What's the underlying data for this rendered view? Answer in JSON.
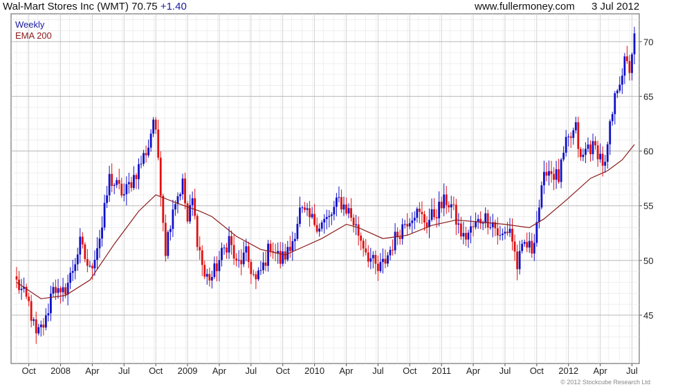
{
  "header": {
    "title_prefix": "Wal-Mart Stores Inc (WMT) 70.75",
    "change": "+1.40",
    "source": "www.fullermoney.com",
    "date": "3 Jul 2012"
  },
  "footer": {
    "copyright": "© 2012 Stockcube Research Ltd"
  },
  "colors": {
    "up": "#1010c8",
    "down": "#e01010",
    "ema": "#8b1a1a",
    "grid": "#c8c8c8",
    "title_blue": "#1a1aa0"
  },
  "chart_data": {
    "type": "candlestick",
    "title": "Wal-Mart Stores Inc (WMT) 70.75 +1.40",
    "frequency": "Weekly",
    "grid": true,
    "legend_position": "top-left",
    "ylim": [
      41.5,
      72
    ],
    "y_ticks": [
      45,
      50,
      55,
      60,
      65,
      70
    ],
    "x_ticks": [
      {
        "label": "Oct",
        "week": 5
      },
      {
        "label": "2008",
        "week": 18
      },
      {
        "label": "Apr",
        "week": 31
      },
      {
        "label": "Jul",
        "week": 44
      },
      {
        "label": "Oct",
        "week": 57
      },
      {
        "label": "2009",
        "week": 70
      },
      {
        "label": "Apr",
        "week": 83
      },
      {
        "label": "Jul",
        "week": 96
      },
      {
        "label": "Oct",
        "week": 109
      },
      {
        "label": "2010",
        "week": 122
      },
      {
        "label": "Apr",
        "week": 135
      },
      {
        "label": "Jul",
        "week": 148
      },
      {
        "label": "Oct",
        "week": 161
      },
      {
        "label": "2011",
        "week": 174
      },
      {
        "label": "Apr",
        "week": 187
      },
      {
        "label": "Jul",
        "week": 200
      },
      {
        "label": "Oct",
        "week": 213
      },
      {
        "label": "2012",
        "week": 226
      },
      {
        "label": "Apr",
        "week": 239
      },
      {
        "label": "Jul",
        "week": 252
      }
    ],
    "anchor_points": [
      {
        "week": 0,
        "price": 48.0
      },
      {
        "week": 5,
        "price": 46.0
      },
      {
        "week": 8,
        "price": 43.0
      },
      {
        "week": 12,
        "price": 44.5
      },
      {
        "week": 15,
        "price": 48.0
      },
      {
        "week": 18,
        "price": 46.5
      },
      {
        "week": 22,
        "price": 48.5
      },
      {
        "week": 26,
        "price": 51.5
      },
      {
        "week": 30,
        "price": 49.0
      },
      {
        "week": 35,
        "price": 53.0
      },
      {
        "week": 38,
        "price": 57.5
      },
      {
        "week": 44,
        "price": 56.0
      },
      {
        "week": 50,
        "price": 58.5
      },
      {
        "week": 54,
        "price": 60.5
      },
      {
        "week": 56,
        "price": 63.0
      },
      {
        "week": 58,
        "price": 59.5
      },
      {
        "week": 61,
        "price": 51.0
      },
      {
        "week": 64,
        "price": 55.0
      },
      {
        "week": 68,
        "price": 57.0
      },
      {
        "week": 70,
        "price": 53.5
      },
      {
        "week": 72,
        "price": 55.5
      },
      {
        "week": 74,
        "price": 52.0
      },
      {
        "week": 77,
        "price": 48.5
      },
      {
        "week": 80,
        "price": 48.5
      },
      {
        "week": 84,
        "price": 50.5
      },
      {
        "week": 87,
        "price": 52.0
      },
      {
        "week": 90,
        "price": 49.5
      },
      {
        "week": 94,
        "price": 50.5
      },
      {
        "week": 98,
        "price": 48.0
      },
      {
        "week": 101,
        "price": 49.5
      },
      {
        "week": 104,
        "price": 51.5
      },
      {
        "week": 108,
        "price": 50.0
      },
      {
        "week": 112,
        "price": 51.0
      },
      {
        "week": 116,
        "price": 54.5
      },
      {
        "week": 120,
        "price": 53.8
      },
      {
        "week": 124,
        "price": 53.3
      },
      {
        "week": 128,
        "price": 53.8
      },
      {
        "week": 132,
        "price": 55.5
      },
      {
        "week": 136,
        "price": 54.5
      },
      {
        "week": 140,
        "price": 52.5
      },
      {
        "week": 144,
        "price": 50.5
      },
      {
        "week": 148,
        "price": 49.0
      },
      {
        "week": 151,
        "price": 50.0
      },
      {
        "week": 155,
        "price": 52.0
      },
      {
        "week": 159,
        "price": 53.5
      },
      {
        "week": 163,
        "price": 54.5
      },
      {
        "week": 168,
        "price": 53.5
      },
      {
        "week": 172,
        "price": 54.5
      },
      {
        "week": 176,
        "price": 55.5
      },
      {
        "week": 178,
        "price": 55.0
      },
      {
        "week": 181,
        "price": 53.0
      },
      {
        "week": 183,
        "price": 52.0
      },
      {
        "week": 187,
        "price": 53.0
      },
      {
        "week": 191,
        "price": 54.0
      },
      {
        "week": 195,
        "price": 53.5
      },
      {
        "week": 198,
        "price": 52.0
      },
      {
        "week": 202,
        "price": 53.0
      },
      {
        "week": 205,
        "price": 49.5
      },
      {
        "week": 208,
        "price": 51.5
      },
      {
        "week": 211,
        "price": 51.0
      },
      {
        "week": 214,
        "price": 55.0
      },
      {
        "week": 217,
        "price": 58.5
      },
      {
        "week": 222,
        "price": 57.5
      },
      {
        "week": 225,
        "price": 60.5
      },
      {
        "week": 229,
        "price": 62.0
      },
      {
        "week": 231,
        "price": 59.0
      },
      {
        "week": 234,
        "price": 60.5
      },
      {
        "week": 238,
        "price": 60.0
      },
      {
        "week": 241,
        "price": 58.5
      },
      {
        "week": 243,
        "price": 62.0
      },
      {
        "week": 246,
        "price": 66.0
      },
      {
        "week": 249,
        "price": 68.0
      },
      {
        "week": 251,
        "price": 67.5
      },
      {
        "week": 253,
        "price": 70.75
      }
    ],
    "series": [
      {
        "name": "Weekly",
        "kind": "candlestick",
        "color_up": "#1010c8",
        "color_down": "#e01010"
      },
      {
        "name": "EMA 200",
        "kind": "line",
        "color": "#8b1a1a",
        "points": [
          {
            "week": 0,
            "price": 48.0
          },
          {
            "week": 10,
            "price": 46.5
          },
          {
            "week": 20,
            "price": 46.8
          },
          {
            "week": 30,
            "price": 48.2
          },
          {
            "week": 40,
            "price": 51.5
          },
          {
            "week": 50,
            "price": 54.5
          },
          {
            "week": 57,
            "price": 56.0
          },
          {
            "week": 65,
            "price": 55.3
          },
          {
            "week": 75,
            "price": 54.5
          },
          {
            "week": 80,
            "price": 54.0
          },
          {
            "week": 90,
            "price": 52.2
          },
          {
            "week": 100,
            "price": 51.0
          },
          {
            "week": 110,
            "price": 50.5
          },
          {
            "week": 115,
            "price": 51.0
          },
          {
            "week": 125,
            "price": 52.0
          },
          {
            "week": 135,
            "price": 53.3
          },
          {
            "week": 140,
            "price": 53.0
          },
          {
            "week": 150,
            "price": 52.0
          },
          {
            "week": 160,
            "price": 52.3
          },
          {
            "week": 170,
            "price": 53.2
          },
          {
            "week": 180,
            "price": 53.7
          },
          {
            "week": 190,
            "price": 53.5
          },
          {
            "week": 200,
            "price": 53.3
          },
          {
            "week": 210,
            "price": 53.0
          },
          {
            "week": 216,
            "price": 53.8
          },
          {
            "week": 225,
            "price": 55.5
          },
          {
            "week": 235,
            "price": 57.5
          },
          {
            "week": 242,
            "price": 58.2
          },
          {
            "week": 248,
            "price": 59.2
          },
          {
            "week": 253,
            "price": 60.6
          }
        ]
      }
    ]
  }
}
